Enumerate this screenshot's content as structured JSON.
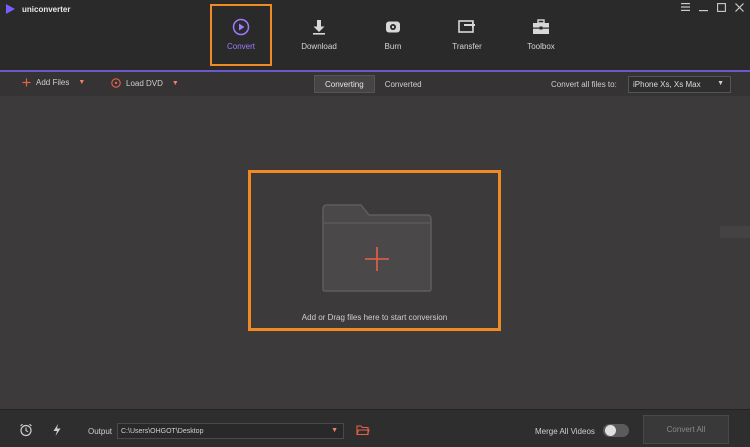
{
  "app": {
    "title": "uniconverter"
  },
  "nav": {
    "items": [
      {
        "label": "Convert",
        "icon": "convert-icon"
      },
      {
        "label": "Download",
        "icon": "download-icon"
      },
      {
        "label": "Burn",
        "icon": "burn-icon"
      },
      {
        "label": "Transfer",
        "icon": "transfer-icon"
      },
      {
        "label": "Toolbox",
        "icon": "toolbox-icon"
      }
    ],
    "active": "Convert"
  },
  "toolbar": {
    "add_files": "Add Files",
    "load_dvd": "Load DVD",
    "tabs": [
      "Converting",
      "Converted"
    ],
    "active_tab": "Converting",
    "convert_all_label": "Convert all files to:",
    "convert_all_value": "iPhone Xs, Xs Max"
  },
  "main": {
    "drop_text": "Add or Drag files here to start conversion"
  },
  "footer": {
    "output_label": "Output",
    "output_path": "C:\\Users\\OHGOT\\Desktop",
    "merge_label": "Merge All Videos",
    "merge_enabled": false,
    "convert_all_button": "Convert All"
  },
  "colors": {
    "accent": "#9b7cff",
    "highlight": "#f08a24",
    "plus": "#e8604a"
  }
}
